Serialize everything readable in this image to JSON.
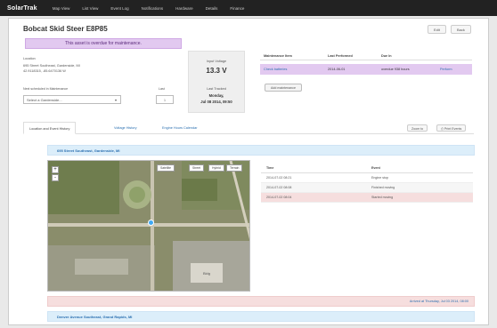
{
  "nav": {
    "brand": "SolarTrak",
    "items": [
      "Map View",
      "List View",
      "Event Log",
      "Notifications",
      "Hardware",
      "Details",
      "Finance"
    ]
  },
  "asset": {
    "title": "Bobcat Skid Steer E8P85",
    "alert": "This asset is overdue for maintenance.",
    "buttons": {
      "edit": "Edit",
      "back": "Back"
    },
    "location_label": "Location",
    "location_line1": "695 Street Southeast, Gardenside, MI",
    "location_line2": "42.9118315, -85.6470136 W",
    "next_maintenance_label": "Next scheduled in Maintenance",
    "last_label": "Last",
    "select_value": "Select a Gardenside...",
    "last_value": "1"
  },
  "status_box": {
    "voltage_label": "Input Voltage",
    "voltage_value": "13.3 V",
    "last_tracked_label": "Last Tracked",
    "last_tracked_day": "Monday,",
    "last_tracked_date": "Jul 08 2014, 09:50"
  },
  "maintenance": {
    "headers": [
      "Maintenance Item",
      "Last Performed",
      "Due In",
      ""
    ],
    "rows": [
      {
        "item": "Check batteries",
        "last": "2014-06-01",
        "due": "overdue 938 hours",
        "action": "Perform"
      }
    ],
    "add_button": "Add maintenance"
  },
  "tabs": {
    "items": [
      "Location and Event History",
      "Voltage History",
      "Engine Hours Calendar"
    ],
    "right_buttons": [
      "Zoom to",
      "Print Events"
    ]
  },
  "location_header": "695 Street Southeast, Gardenside, MI",
  "map": {
    "controls": [
      "Satellite",
      "Street",
      "Hybrid",
      "Terrain"
    ],
    "zoom_in": "+",
    "zoom_out": "-",
    "building_label": "Bldg"
  },
  "events": {
    "headers": [
      "Time",
      "Event"
    ],
    "rows": [
      {
        "time": "2014-07-02 08:21",
        "event": "Engine stop"
      },
      {
        "time": "2014-07-02 08:08",
        "event": "Finished moving"
      },
      {
        "time": "2014-07-02 08:04",
        "event": "Started moving"
      }
    ]
  },
  "footer_note": "Arrived at Thursday, Jul 03 2014, 08:00",
  "location_header_2": "Denver Avenue Southeast, Grand Rapids, MI"
}
